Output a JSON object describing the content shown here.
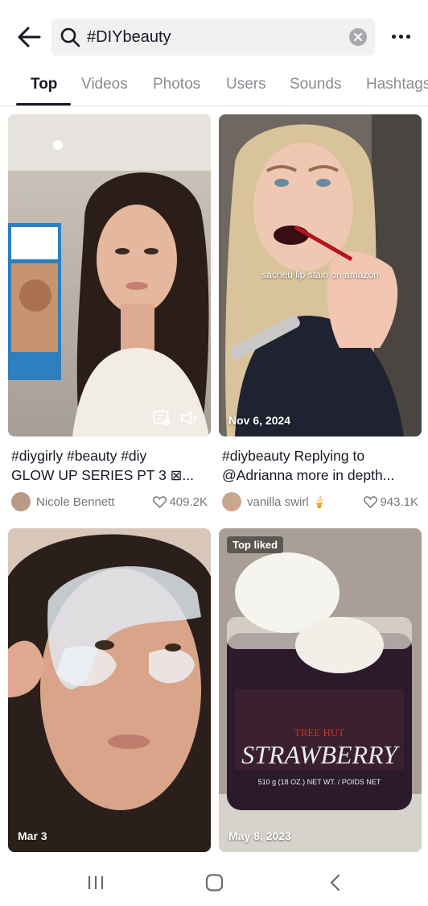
{
  "search": {
    "query": "#DIYbeauty"
  },
  "tabs": [
    "Top",
    "Videos",
    "Photos",
    "Users",
    "Sounds",
    "Hashtags"
  ],
  "results": [
    {
      "title_line1": "#diygirly #beauty #diy",
      "title_line2": "GLOW UP SERIES PT 3 ⊠...",
      "author": "Nicole Bennett",
      "likes": "409.2K",
      "date": ""
    },
    {
      "title_line1": "#diybeauty Replying to",
      "title_line2": "@Adrianna more in depth...",
      "author": "vanilla swirl 🍦",
      "likes": "943.1K",
      "date": "Nov 6, 2024",
      "overlay_caption": "sacheu lip stain on amazon"
    },
    {
      "date": "Mar 3"
    },
    {
      "badge": "Top liked",
      "date": "May 8, 2023",
      "product_brand": "TREE HUT",
      "product_name": "STRAWBERRY",
      "product_size": "510 g (18 OZ.) NET WT. / POIDS NET"
    }
  ],
  "colors": {
    "text_primary": "#161823",
    "text_secondary": "#75767b",
    "tab_inactive": "#8a8b91",
    "search_bg": "#f1f1f2"
  }
}
